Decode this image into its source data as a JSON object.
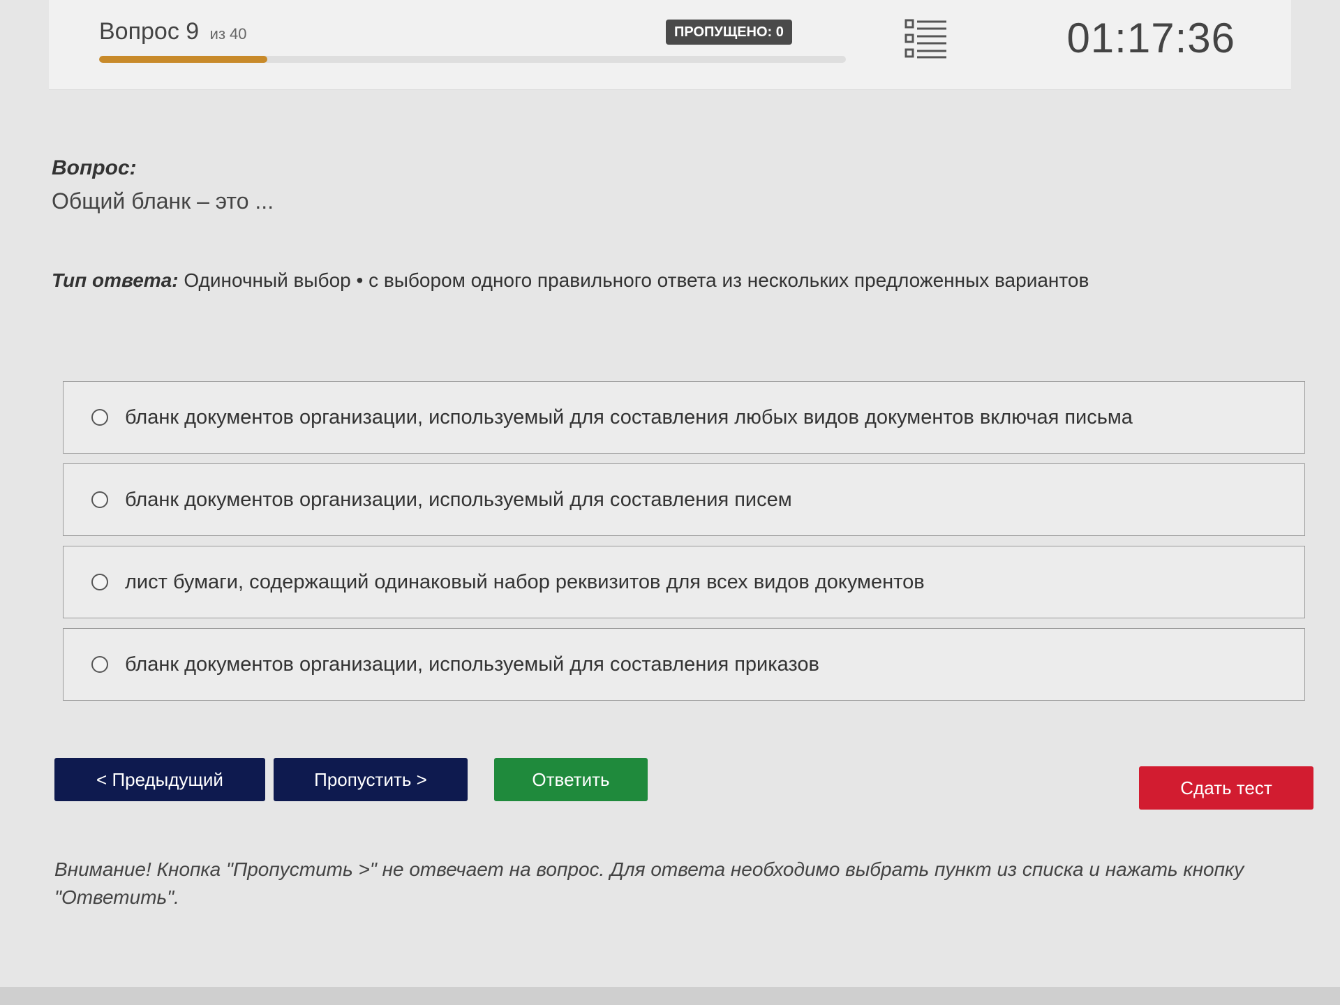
{
  "header": {
    "question_word": "Вопрос",
    "question_number": "9",
    "of_word": "из",
    "total": "40",
    "progress": 0.225,
    "skipped_label": "ПРОПУЩЕНО: 0",
    "timer": "01:17:36"
  },
  "question": {
    "label": "Вопрос:",
    "text": "Общий бланк – это ..."
  },
  "answer_type": {
    "label": "Тип ответа:",
    "value": "Одиночный выбор • с выбором одного правильного ответа из нескольких предложенных вариантов"
  },
  "options": [
    {
      "text": "бланк документов организации, используемый для составления любых видов документов включая письма"
    },
    {
      "text": "бланк документов организации, используемый для составления писем"
    },
    {
      "text": "лист бумаги, содержащий одинаковый набор реквизитов для всех видов документов"
    },
    {
      "text": "бланк документов организации, используемый для составления приказов"
    }
  ],
  "buttons": {
    "prev": "< Предыдущий",
    "skip": "Пропустить >",
    "answer": "Ответить",
    "submit": "Сдать тест"
  },
  "warning": "Внимание! Кнопка \"Пропустить >\" не отвечает на вопрос. Для ответа необходимо выбрать пункт из списка и нажать кнопку \"Ответить\".",
  "icons": {
    "question_list": "list-icon",
    "radio": "radio-icon"
  },
  "colors": {
    "progress": "#c88a2a",
    "nav_button": "#0e1a4f",
    "answer_button": "#1f8a3c",
    "submit_button": "#d21c30"
  }
}
